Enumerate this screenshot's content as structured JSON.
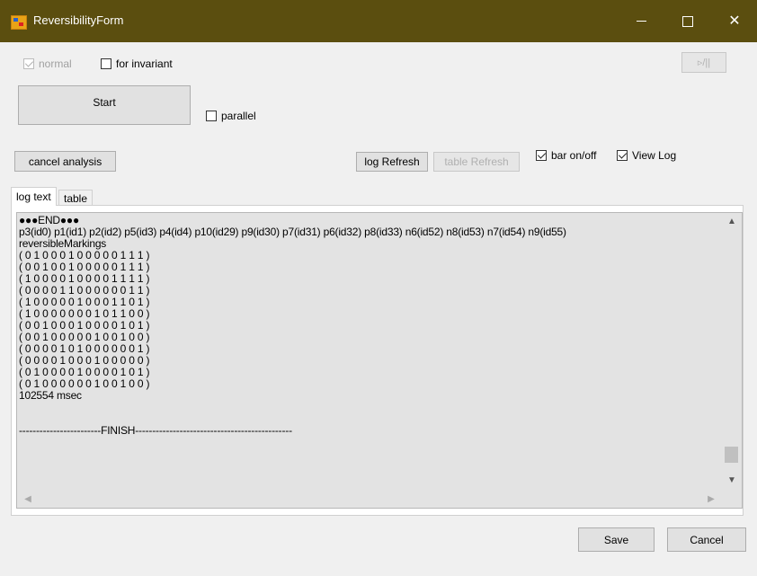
{
  "window": {
    "title": "ReversibilityForm",
    "controls": {
      "minimize": "minimize-icon",
      "maximize": "maximize-icon",
      "close": "✕"
    }
  },
  "options": {
    "normal_label": "normal",
    "normal_checked": true,
    "normal_disabled": true,
    "invariant_label": "for invariant",
    "invariant_checked": false,
    "parallel_label": "parallel",
    "parallel_checked": false,
    "bar_label": "bar on/off",
    "bar_checked": true,
    "viewlog_label": "View Log",
    "viewlog_checked": true
  },
  "buttons": {
    "play_pause": "▹/||",
    "start": "Start",
    "cancel_analysis": "cancel analysis",
    "log_refresh": "log Refresh",
    "table_refresh": "table Refresh",
    "save": "Save",
    "cancel": "Cancel"
  },
  "tabs": [
    {
      "label": "log text",
      "active": true
    },
    {
      "label": "table",
      "active": false
    }
  ],
  "log": {
    "lines": [
      "●●●END●●●",
      "p3(id0) p1(id1) p2(id2) p5(id3) p4(id4) p10(id29) p9(id30) p7(id31) p6(id32) p8(id33) n6(id52) n8(id53) n7(id54) n9(id55)",
      "reversibleMarkings",
      "( 0 1 0 0 0 1 0 0 0 0 0 1 1 1 )",
      "( 0 0 1 0 0 1 0 0 0 0 0 1 1 1 )",
      "( 1 0 0 0 0 1 0 0 0 0 1 1 1 1 )",
      "( 0 0 0 0 1 1 0 0 0 0 0 0 1 1 )",
      "( 1 0 0 0 0 0 1 0 0 0 1 1 0 1 )",
      "( 1 0 0 0 0 0 0 0 1 0 1 1 0 0 )",
      "( 0 0 1 0 0 0 1 0 0 0 0 1 0 1 )",
      "( 0 0 1 0 0 0 0 0 1 0 0 1 0 0 )",
      "( 0 0 0 0 1 0 1 0 0 0 0 0 0 1 )",
      "( 0 0 0 0 1 0 0 0 1 0 0 0 0 0 )",
      "( 0 1 0 0 0 0 1 0 0 0 0 1 0 1 )",
      "( 0 1 0 0 0 0 0 0 1 0 0 1 0 0 )",
      "102554 msec",
      "",
      "",
      "------------------------FINISH----------------------------------------------"
    ]
  }
}
